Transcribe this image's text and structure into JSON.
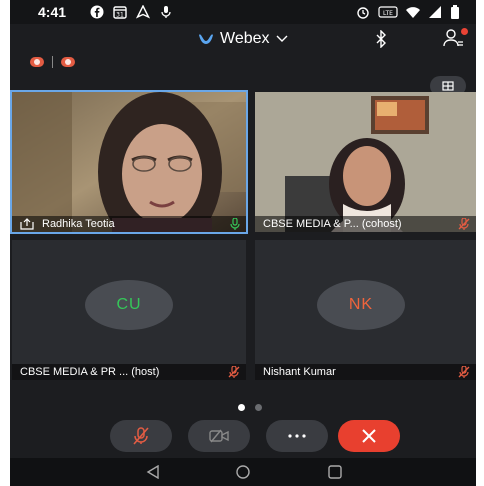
{
  "status_bar": {
    "time": "4:41",
    "left_icons": [
      "facebook-icon",
      "calendar-icon",
      "navigation-icon",
      "mic-icon"
    ],
    "right_icons": [
      "alarm-icon",
      "volte-icon",
      "wifi-icon",
      "signal-icon",
      "battery-icon"
    ]
  },
  "header": {
    "app_name": "Webex",
    "icons": [
      "webex-logo-icon",
      "chevron-down-icon",
      "bluetooth-icon",
      "participants-icon"
    ]
  },
  "recording": {
    "indicators": [
      "recording-icon",
      "recording-icon"
    ]
  },
  "participants": [
    {
      "name": "Radhika Teotia",
      "video": true,
      "share_icon": true,
      "mic": "unmuted",
      "active_speaker": true
    },
    {
      "name": "CBSE MEDIA & P... (cohost)",
      "video": true,
      "mic": "muted"
    },
    {
      "name": "CBSE MEDIA & PR ... (host)",
      "video": false,
      "initials": "CU",
      "initials_color": "#35c759",
      "mic": "muted"
    },
    {
      "name": "Nishant Kumar",
      "video": false,
      "initials": "NK",
      "initials_color": "#f0643c",
      "mic": "muted"
    }
  ],
  "pager": {
    "pages": 2,
    "current": 1
  },
  "controls": [
    "mute-icon",
    "video-off-icon",
    "more-icon",
    "leave-icon"
  ],
  "nav": [
    "back-icon",
    "home-icon",
    "recents-icon"
  ],
  "colors": {
    "accent": "#6aa7e8",
    "leave": "#e8402f",
    "muted": "#e35c43",
    "unmuted": "#35c759"
  }
}
